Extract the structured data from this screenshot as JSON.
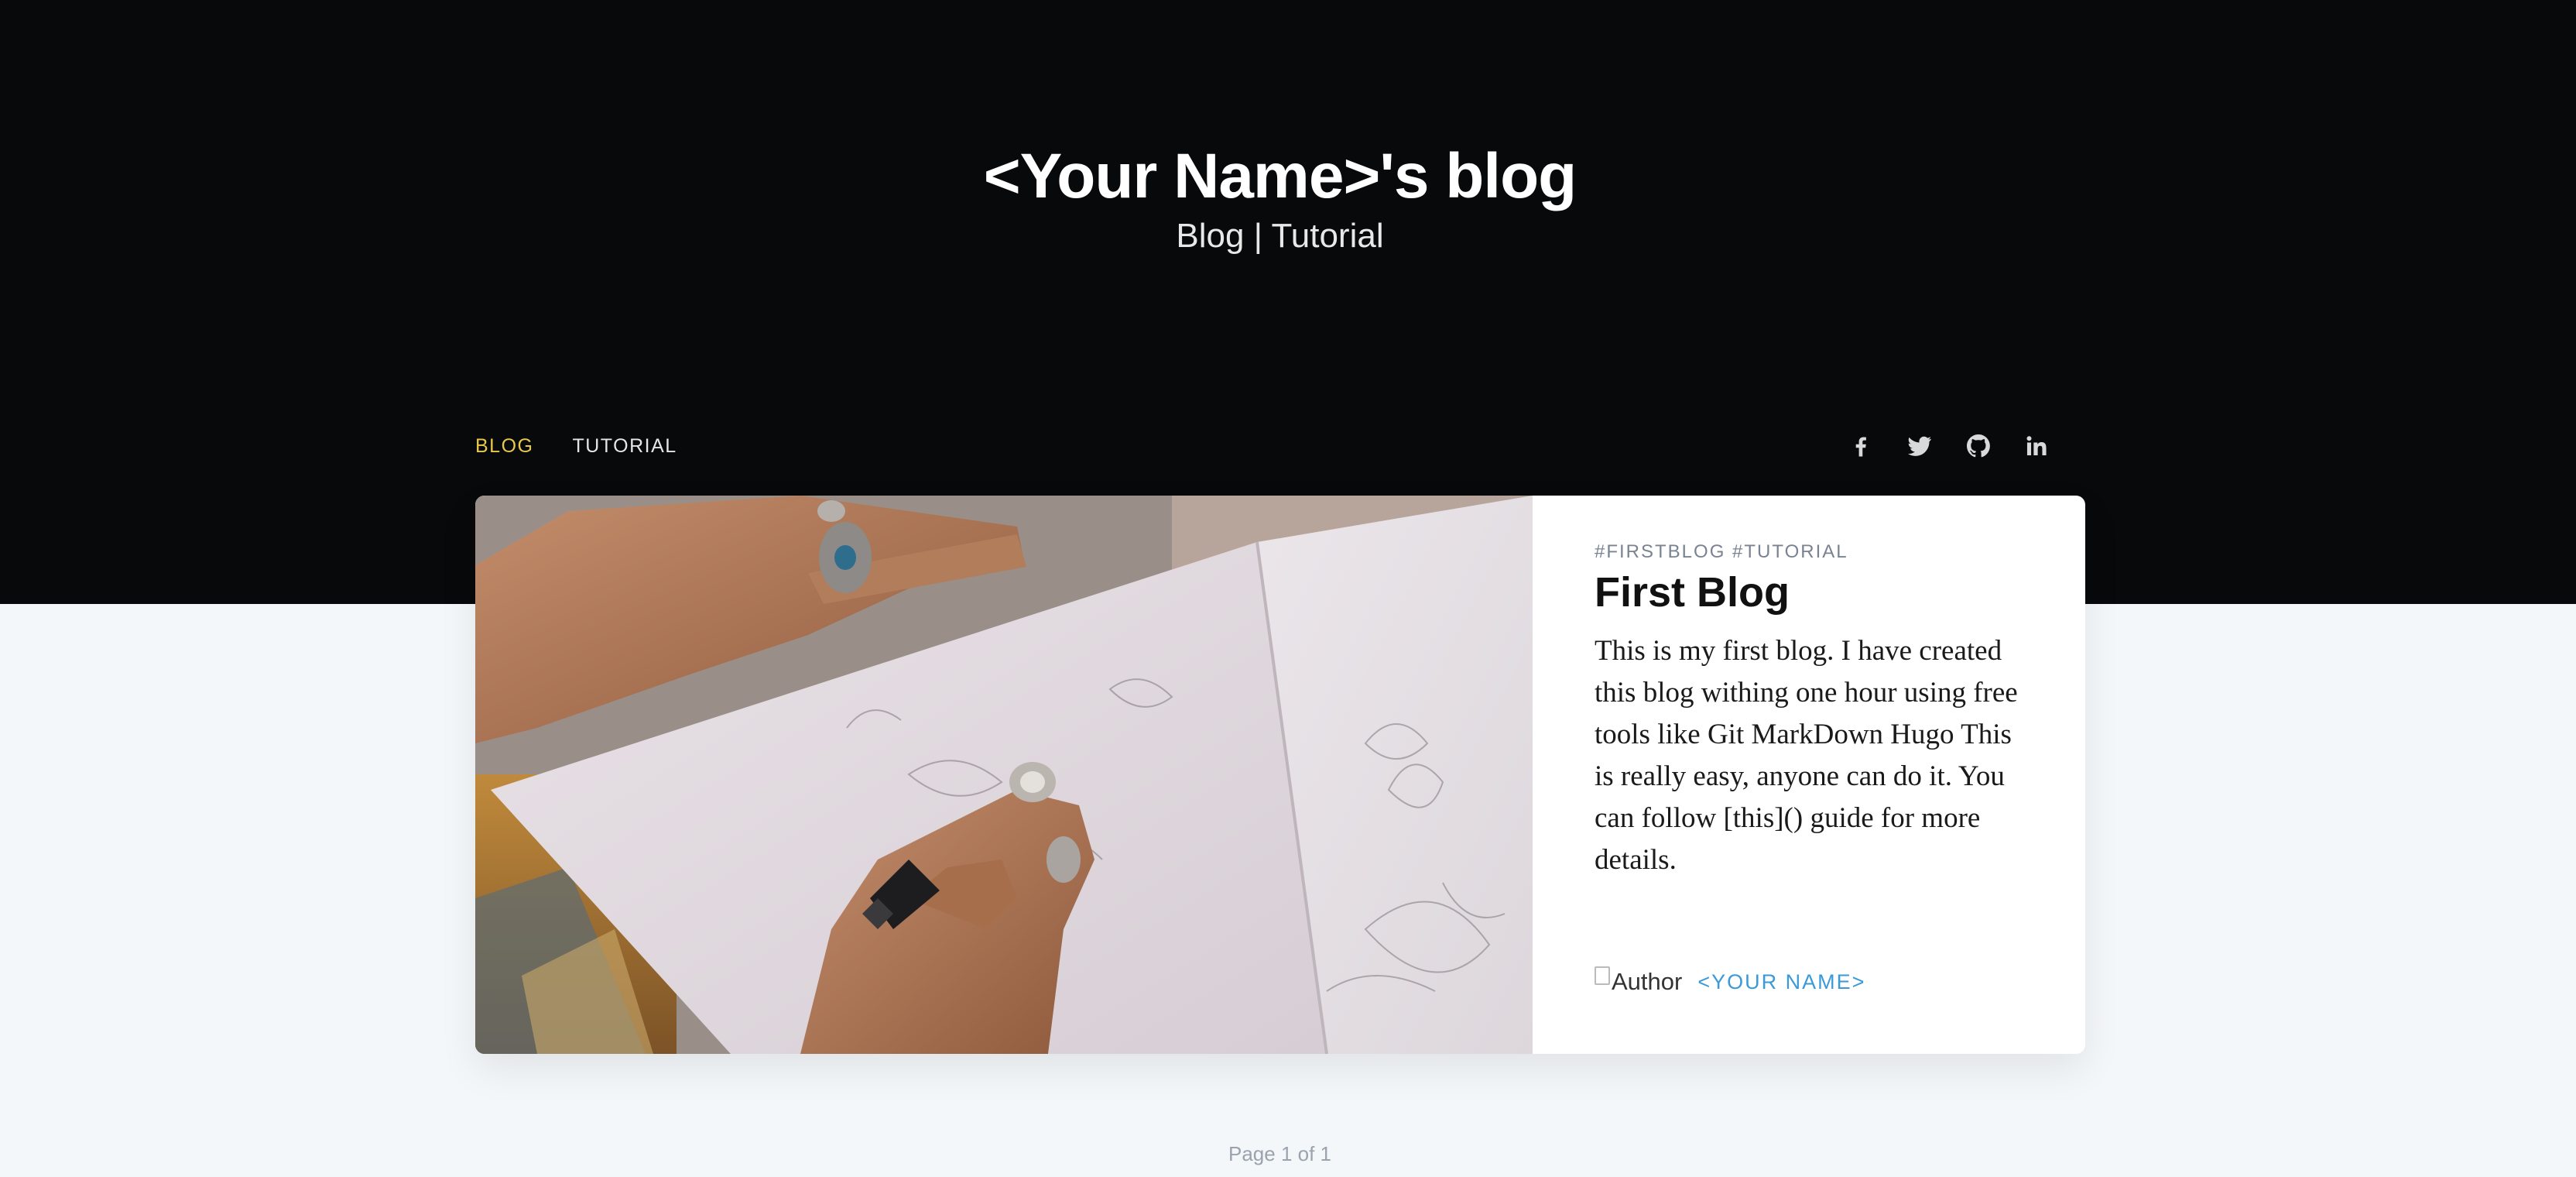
{
  "header": {
    "title": "<Your Name>'s blog",
    "subtitle": "Blog | Tutorial"
  },
  "nav": {
    "items": [
      {
        "label": "BLOG",
        "active": true
      },
      {
        "label": "TUTORIAL",
        "active": false
      }
    ]
  },
  "social": {
    "icons": [
      "facebook-icon",
      "twitter-icon",
      "github-icon",
      "linkedin-icon"
    ]
  },
  "post": {
    "tags": "#FIRSTBLOG #TUTORIAL",
    "title": "First Blog",
    "excerpt": "This is my first blog. I have created this blog withing one hour using free tools like Git MarkDown Hugo This is really easy, anyone can do it. You can follow [this]() guide for more details.",
    "author_alt": "Author",
    "author_name": "<YOUR NAME>"
  },
  "pagination": {
    "text": "Page 1 of 1"
  },
  "colors": {
    "hero_bg": "#08090b",
    "page_bg": "#f4f7f9",
    "nav_active": "#e9c94a",
    "author_link": "#3a9ad9"
  }
}
